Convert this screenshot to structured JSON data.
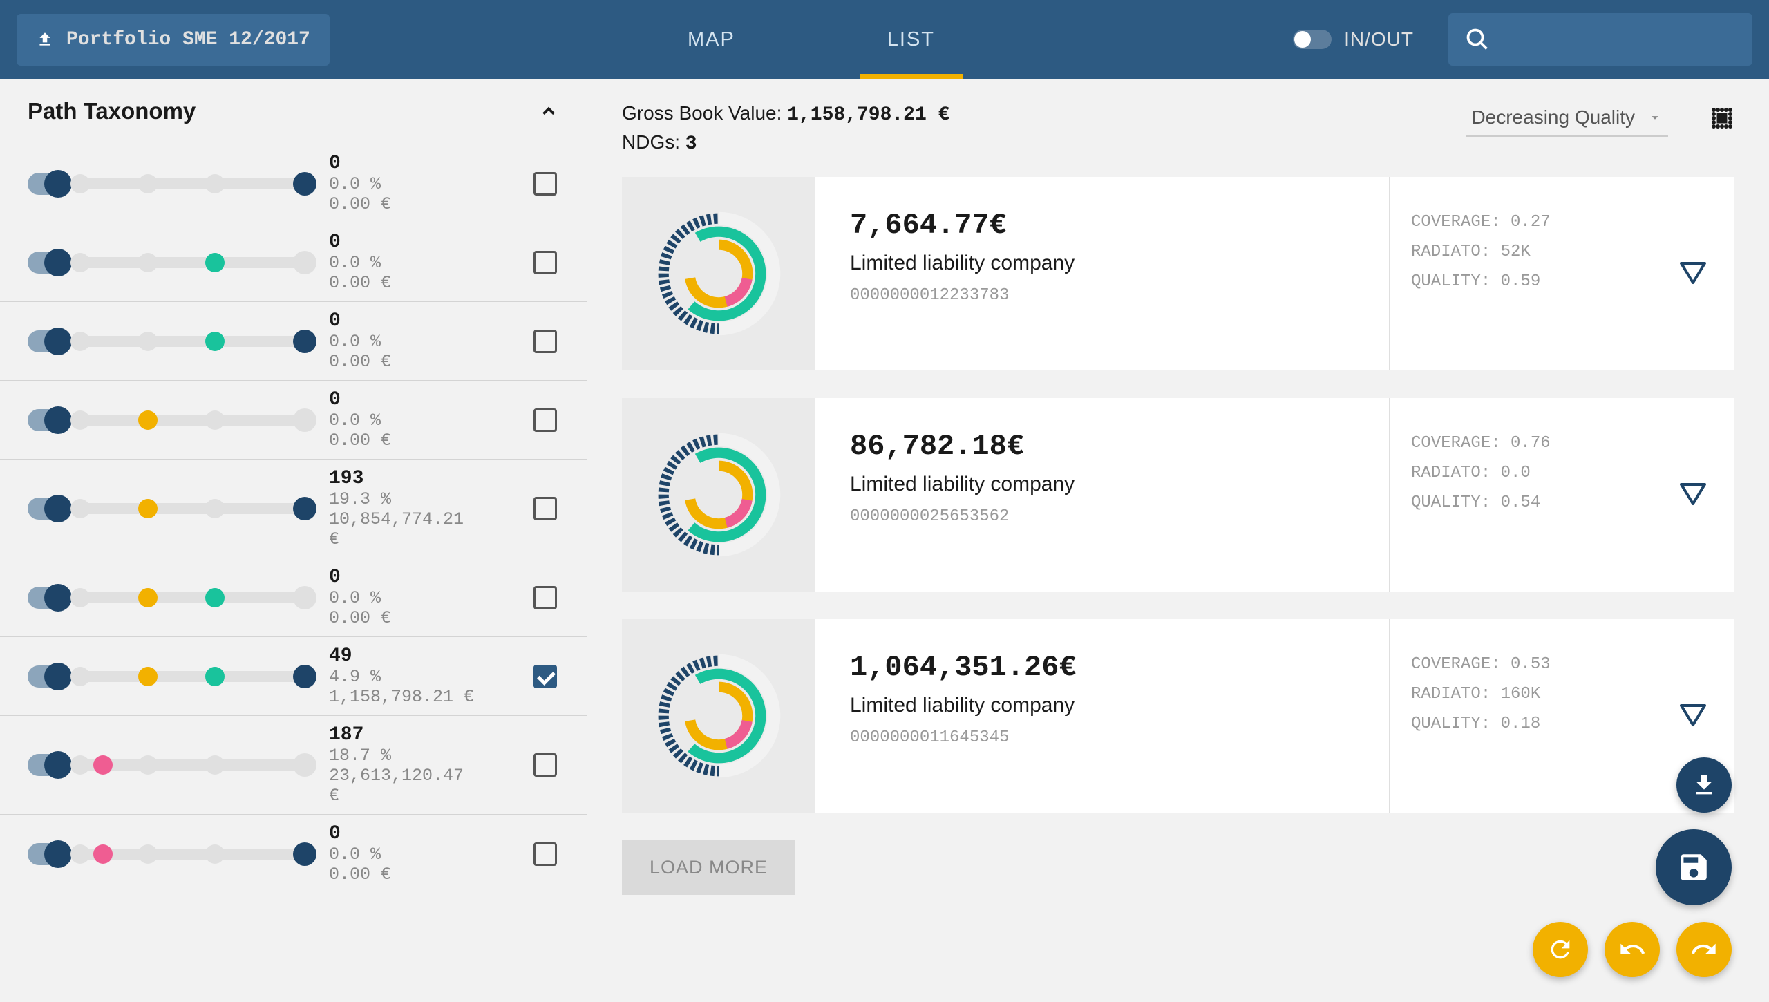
{
  "header": {
    "portfolio_label": "Portfolio SME 12/2017",
    "tabs": {
      "map": "MAP",
      "list": "LIST"
    },
    "inout_label": "IN/OUT"
  },
  "sidebar": {
    "title": "Path Taxonomy",
    "rows": [
      {
        "count": "0",
        "pct": "0.0 %",
        "eur": "0.00 €",
        "checked": false,
        "dots": [
          {
            "pos": 100,
            "color": "blue",
            "end": true
          }
        ]
      },
      {
        "count": "0",
        "pct": "0.0 %",
        "eur": "0.00 €",
        "checked": false,
        "dots": [
          {
            "pos": 60,
            "color": "teal"
          },
          {
            "pos": 100,
            "color": "gray",
            "end": true
          }
        ]
      },
      {
        "count": "0",
        "pct": "0.0 %",
        "eur": "0.00 €",
        "checked": false,
        "dots": [
          {
            "pos": 60,
            "color": "teal"
          },
          {
            "pos": 100,
            "color": "blue",
            "end": true
          }
        ]
      },
      {
        "count": "0",
        "pct": "0.0 %",
        "eur": "0.00 €",
        "checked": false,
        "dots": [
          {
            "pos": 30,
            "color": "yellow"
          },
          {
            "pos": 100,
            "color": "gray",
            "end": true
          }
        ]
      },
      {
        "count": "193",
        "pct": "19.3 %",
        "eur": "10,854,774.21 €",
        "checked": false,
        "dots": [
          {
            "pos": 30,
            "color": "yellow"
          },
          {
            "pos": 100,
            "color": "blue",
            "end": true
          }
        ]
      },
      {
        "count": "0",
        "pct": "0.0 %",
        "eur": "0.00 €",
        "checked": false,
        "dots": [
          {
            "pos": 30,
            "color": "yellow"
          },
          {
            "pos": 60,
            "color": "teal"
          },
          {
            "pos": 100,
            "color": "gray",
            "end": true
          }
        ]
      },
      {
        "count": "49",
        "pct": "4.9 %",
        "eur": "1,158,798.21 €",
        "checked": true,
        "dots": [
          {
            "pos": 30,
            "color": "yellow"
          },
          {
            "pos": 60,
            "color": "teal"
          },
          {
            "pos": 100,
            "color": "blue",
            "end": true
          }
        ]
      },
      {
        "count": "187",
        "pct": "18.7 %",
        "eur": "23,613,120.47 €",
        "checked": false,
        "dots": [
          {
            "pos": 10,
            "color": "pink"
          },
          {
            "pos": 100,
            "color": "gray",
            "end": true
          }
        ]
      },
      {
        "count": "0",
        "pct": "0.0 %",
        "eur": "0.00 €",
        "checked": false,
        "dots": [
          {
            "pos": 10,
            "color": "pink"
          },
          {
            "pos": 100,
            "color": "blue",
            "end": true
          }
        ]
      }
    ]
  },
  "summary": {
    "gbv_label": "Gross Book Value: ",
    "gbv_value": "1,158,798.21 €",
    "ndgs_label": "NDGs: ",
    "ndgs_value": "3",
    "sort_label": "Decreasing Quality"
  },
  "cards": [
    {
      "amount": "7,664.77€",
      "type": "Limited liability company",
      "id": "0000000012233783",
      "coverage": "0.27",
      "radiato": "52K",
      "quality": "0.59"
    },
    {
      "amount": "86,782.18€",
      "type": "Limited liability company",
      "id": "0000000025653562",
      "coverage": "0.76",
      "radiato": "0.0",
      "quality": "0.54"
    },
    {
      "amount": "1,064,351.26€",
      "type": "Limited liability company",
      "id": "0000000011645345",
      "coverage": "0.53",
      "radiato": "160K",
      "quality": "0.18"
    }
  ],
  "labels": {
    "coverage": "COVERAGE:",
    "radiato": "RADIATO:",
    "quality": "QUALITY:",
    "load_more": "LOAD MORE"
  }
}
